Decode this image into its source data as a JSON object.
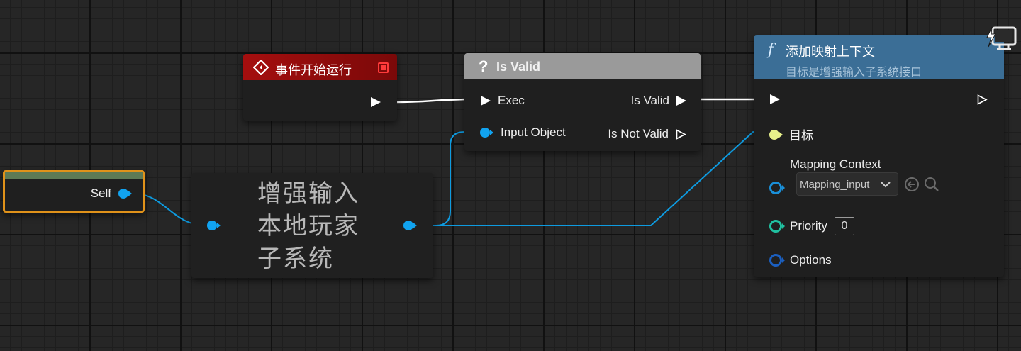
{
  "event_node": {
    "title": "事件开始运行",
    "icon": "event-diamond-icon",
    "header_color": "#9e0c0c"
  },
  "isvalid_node": {
    "title": "Is Valid",
    "icon": "question-mark-icon",
    "header_color": "#9a9a9a",
    "pin_exec": "Exec",
    "pin_input_object": "Input Object",
    "pin_is_valid": "Is Valid",
    "pin_is_not_valid": "Is Not Valid"
  },
  "self_node": {
    "label": "Self",
    "accent": "#e0921a"
  },
  "subsystem_node": {
    "line1": "增强输入",
    "line2": "本地玩家",
    "line3": "子系统"
  },
  "add_mapping_node": {
    "title": "添加映射上下文",
    "subtitle": "目标是增强输入子系统接口",
    "icon": "function-icon",
    "header_color": "#3b6e96",
    "pin_target": "目标",
    "pin_mapping_context": "Mapping Context",
    "mapping_context_value": "Mapping_input",
    "pin_priority": "Priority",
    "priority_value": "0",
    "pin_options": "Options"
  },
  "colors": {
    "exec_wire": "#ffffff",
    "object_wire": "#0e9be0"
  }
}
